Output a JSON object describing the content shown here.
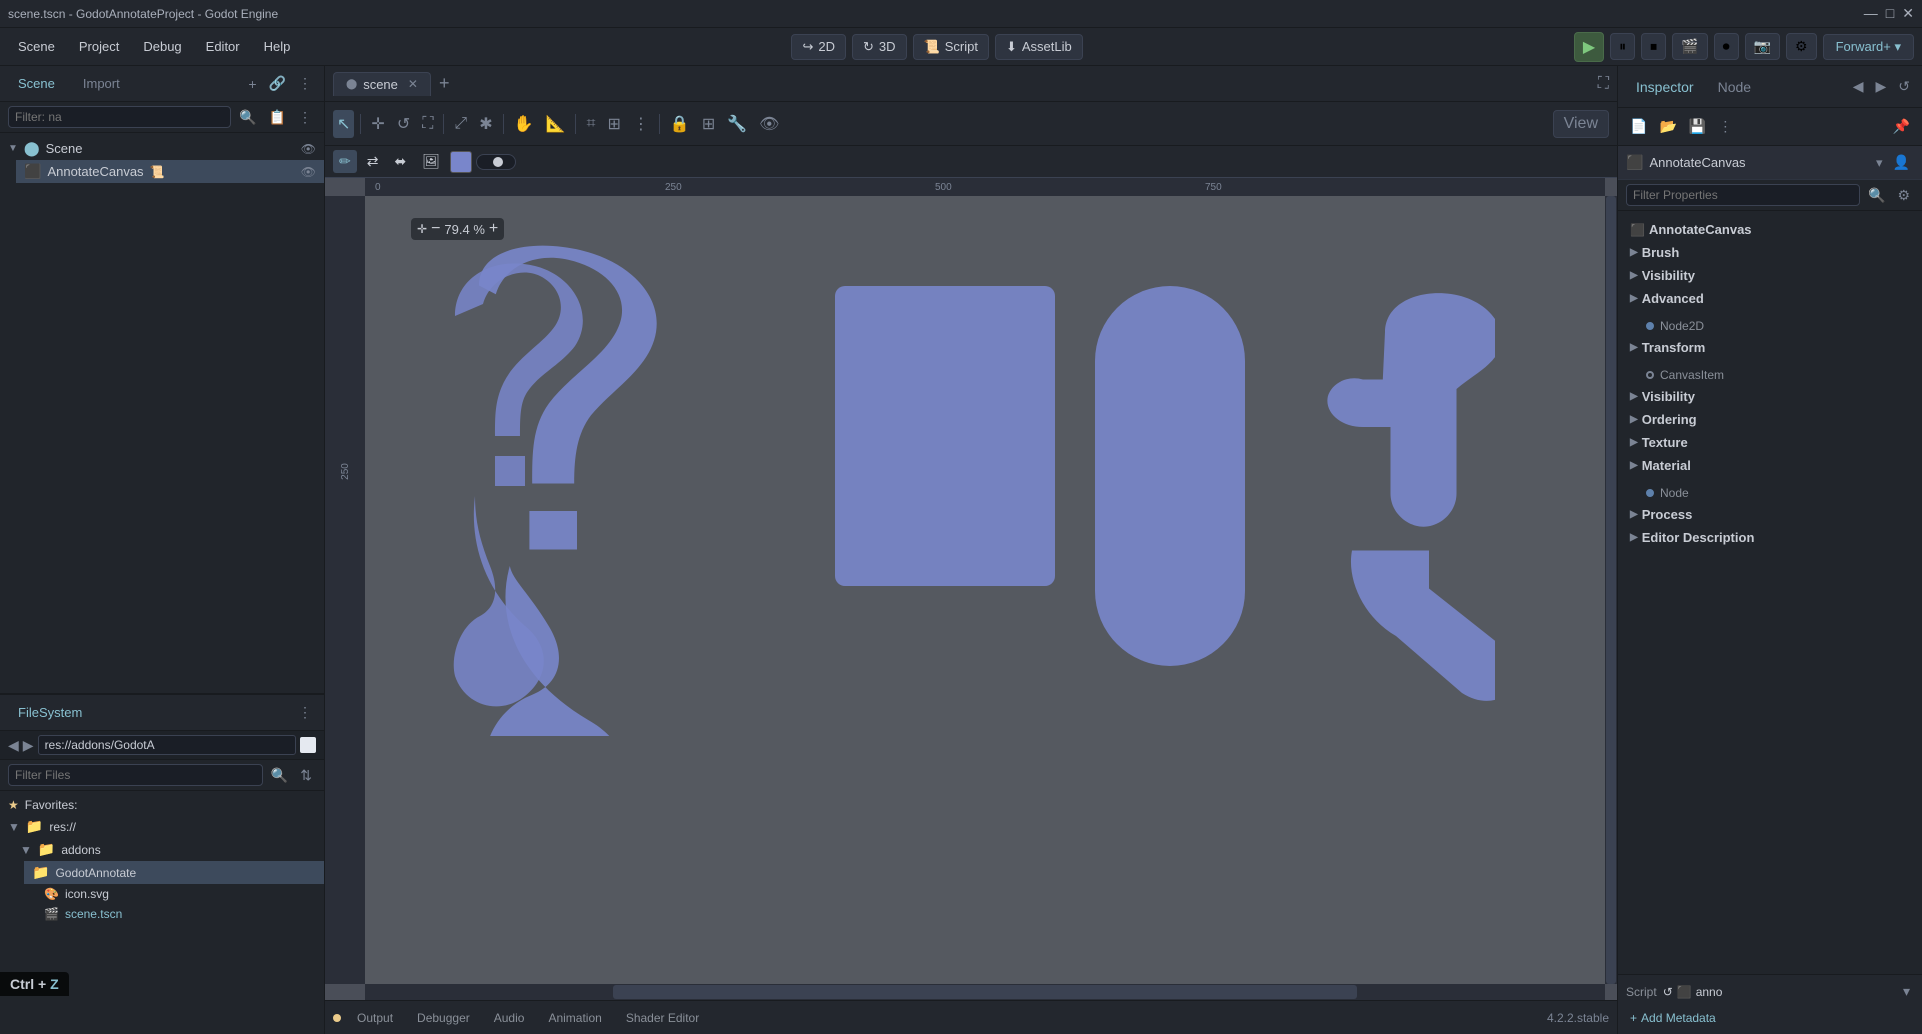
{
  "titlebar": {
    "title": "scene.tscn - GodotAnnotateProject - Godot Engine",
    "min": "—",
    "max": "□",
    "close": "✕"
  },
  "menubar": {
    "items": [
      "Scene",
      "Project",
      "Debug",
      "Editor",
      "Help"
    ],
    "toolbar_2d": "2D",
    "toolbar_3d": "3D",
    "toolbar_script": "Script",
    "toolbar_assetlib": "AssetLib",
    "renderer": "Forward+"
  },
  "scene_panel": {
    "tab_scene": "Scene",
    "tab_import": "Import",
    "filter_placeholder": "Filter: na",
    "root_node": "Scene",
    "child_node": "AnnotateCanvas"
  },
  "filesystem_panel": {
    "title": "FileSystem",
    "path": "res://addons/GodotA",
    "filter_placeholder": "Filter Files",
    "favorites": "Favorites:",
    "res": "res://",
    "addons": "addons",
    "godot_annotate": "GodotAnnotate",
    "icon_svg": "icon.svg",
    "scene_tscn": "scene.tscn"
  },
  "viewport": {
    "tab_name": "scene",
    "zoom": "79.4 %",
    "view_btn": "View"
  },
  "bottom_bar": {
    "output": "Output",
    "debugger": "Debugger",
    "audio": "Audio",
    "animation": "Animation",
    "shader_editor": "Shader Editor",
    "version": "4.2.2.stable"
  },
  "inspector": {
    "tab_inspector": "Inspector",
    "tab_node": "Node",
    "node_name": "AnnotateCanvas",
    "filter_placeholder": "Filter Properties",
    "sections": {
      "annotate_canvas": "AnnotateCanvas",
      "brush": "Brush",
      "visibility": "Visibility",
      "advanced": "Advanced",
      "node2d": "Node2D",
      "transform": "Transform",
      "canvas_item": "CanvasItem",
      "visibility2": "Visibility",
      "ordering": "Ordering",
      "texture": "Texture",
      "material": "Material",
      "node": "Node",
      "process": "Process",
      "editor_description": "Editor Description"
    },
    "script_label": "Script",
    "script_value": "anno",
    "add_meta": "Add Metadata"
  },
  "shortcut": {
    "ctrl": "Ctrl +",
    "key": "Z"
  },
  "ruler": {
    "h_marks": [
      "0",
      "250",
      "500",
      "750"
    ],
    "v_marks": [
      "250"
    ]
  }
}
